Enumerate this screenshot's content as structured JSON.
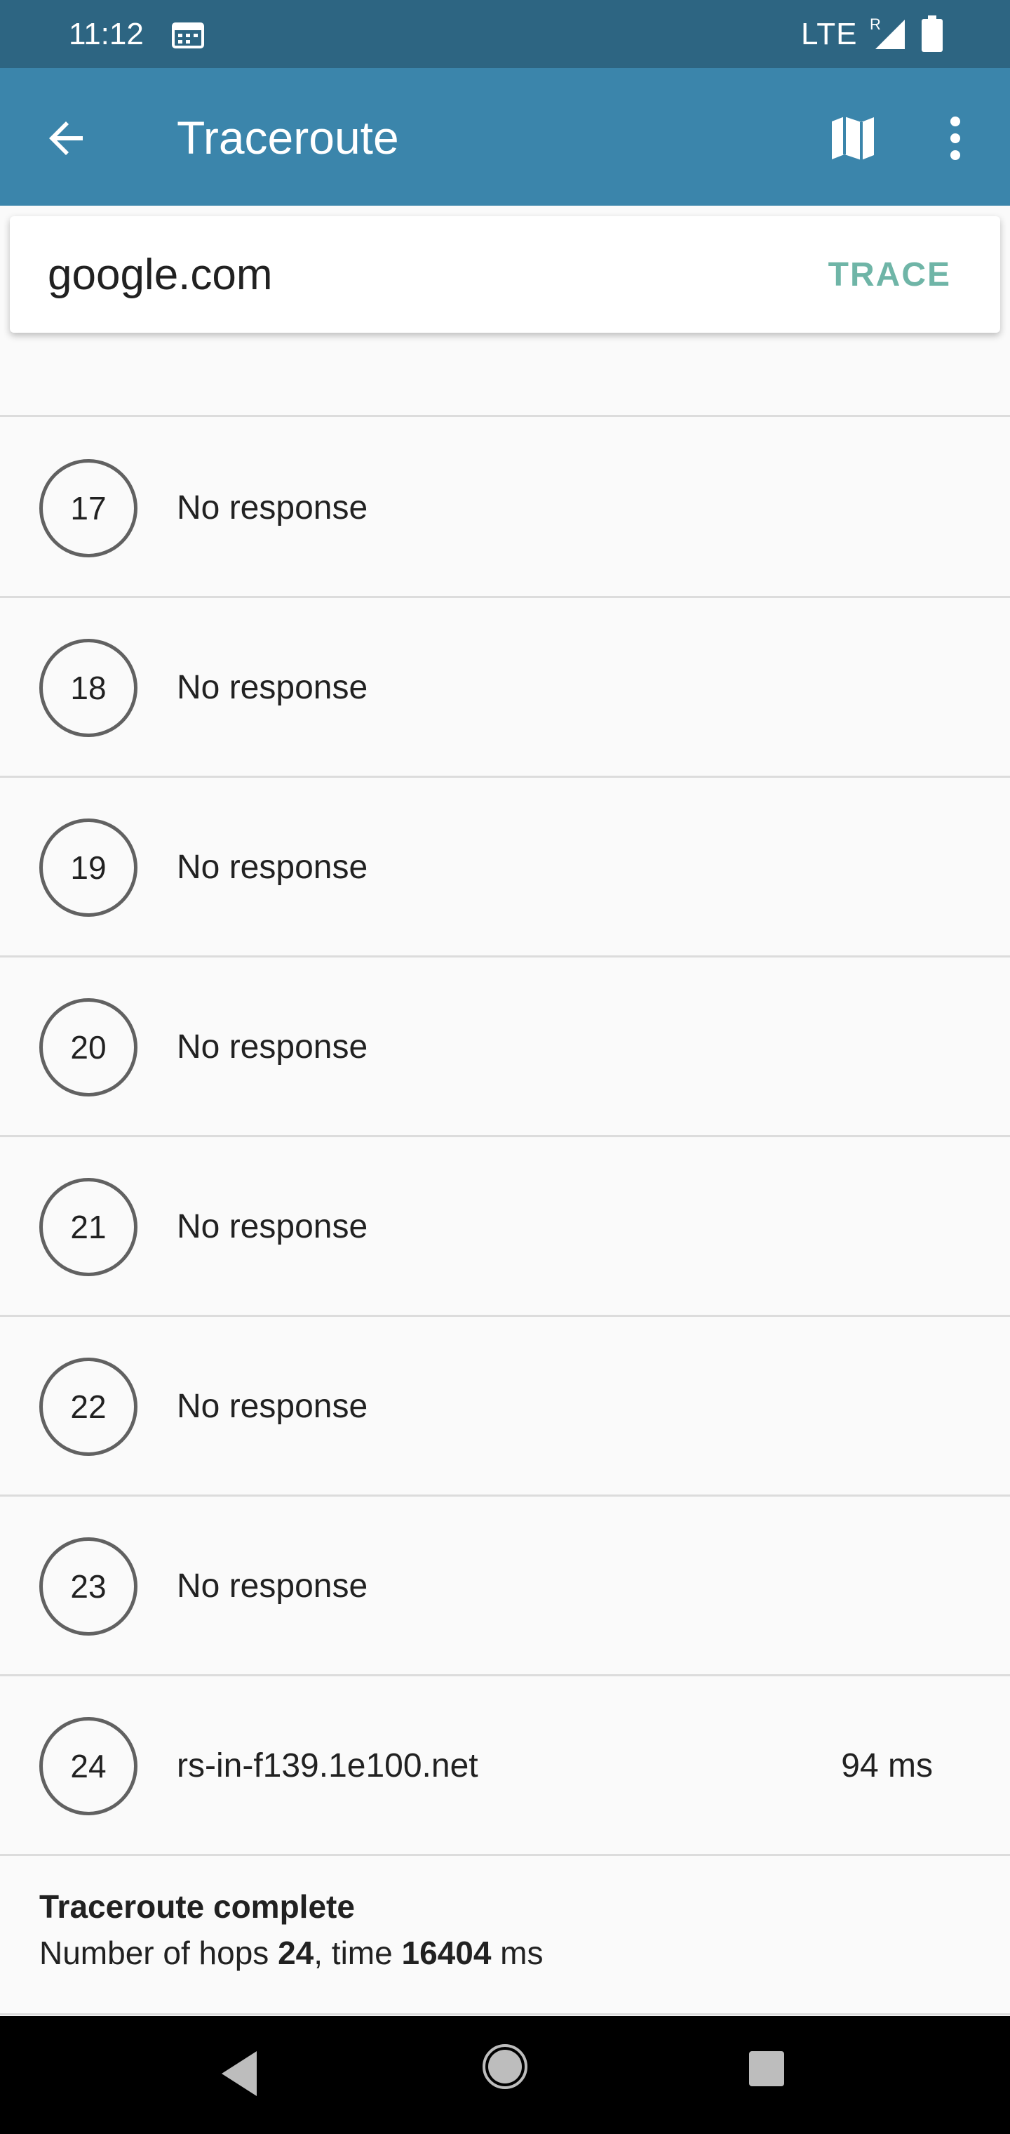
{
  "status_bar": {
    "time": "11:12",
    "network": "LTE",
    "roaming": "R",
    "icons": [
      "calendar-icon",
      "signal-icon",
      "battery-icon"
    ]
  },
  "app_bar": {
    "title": "Traceroute",
    "icons": [
      "back-arrow-icon",
      "map-icon",
      "more-vert-icon"
    ]
  },
  "search": {
    "value": "google.com",
    "trace_label": "TRACE"
  },
  "hops": [
    {
      "num": "17",
      "host": "No response",
      "time": ""
    },
    {
      "num": "18",
      "host": "No response",
      "time": ""
    },
    {
      "num": "19",
      "host": "No response",
      "time": ""
    },
    {
      "num": "20",
      "host": "No response",
      "time": ""
    },
    {
      "num": "21",
      "host": "No response",
      "time": ""
    },
    {
      "num": "22",
      "host": "No response",
      "time": ""
    },
    {
      "num": "23",
      "host": "No response",
      "time": ""
    },
    {
      "num": "24",
      "host": "rs-in-f139.1e100.net",
      "time": "94 ms"
    }
  ],
  "summary": {
    "title": "Traceroute complete",
    "hops_prefix": "Number of hops ",
    "hops": "24",
    "time_prefix": ", time ",
    "time": "16404",
    "time_suffix": " ms"
  },
  "colors": {
    "status_bar": "#2d6582",
    "app_bar": "#3b85ab",
    "accent": "#6fb5a7"
  }
}
